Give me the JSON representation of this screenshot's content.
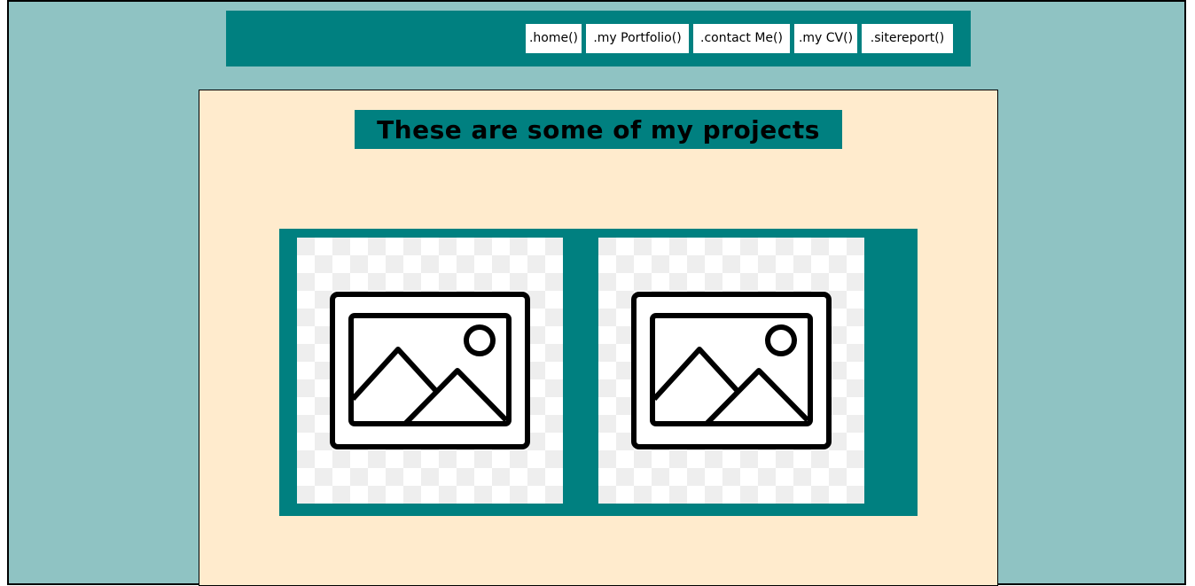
{
  "nav": {
    "items": [
      {
        "label": ".home()"
      },
      {
        "label": ".my Portfolio()"
      },
      {
        "label": ".contact Me()"
      },
      {
        "label": ".my CV()"
      },
      {
        "label": ".sitereport()"
      }
    ]
  },
  "main": {
    "title": "These are some of my projects"
  },
  "gallery": {
    "items": [
      {
        "icon": "image-placeholder-icon"
      },
      {
        "icon": "image-placeholder-icon"
      }
    ]
  },
  "colors": {
    "page_background": "#8fc3c3",
    "accent": "#008080",
    "panel_background": "#ffebcd",
    "nav_item_background": "#ffffff"
  }
}
